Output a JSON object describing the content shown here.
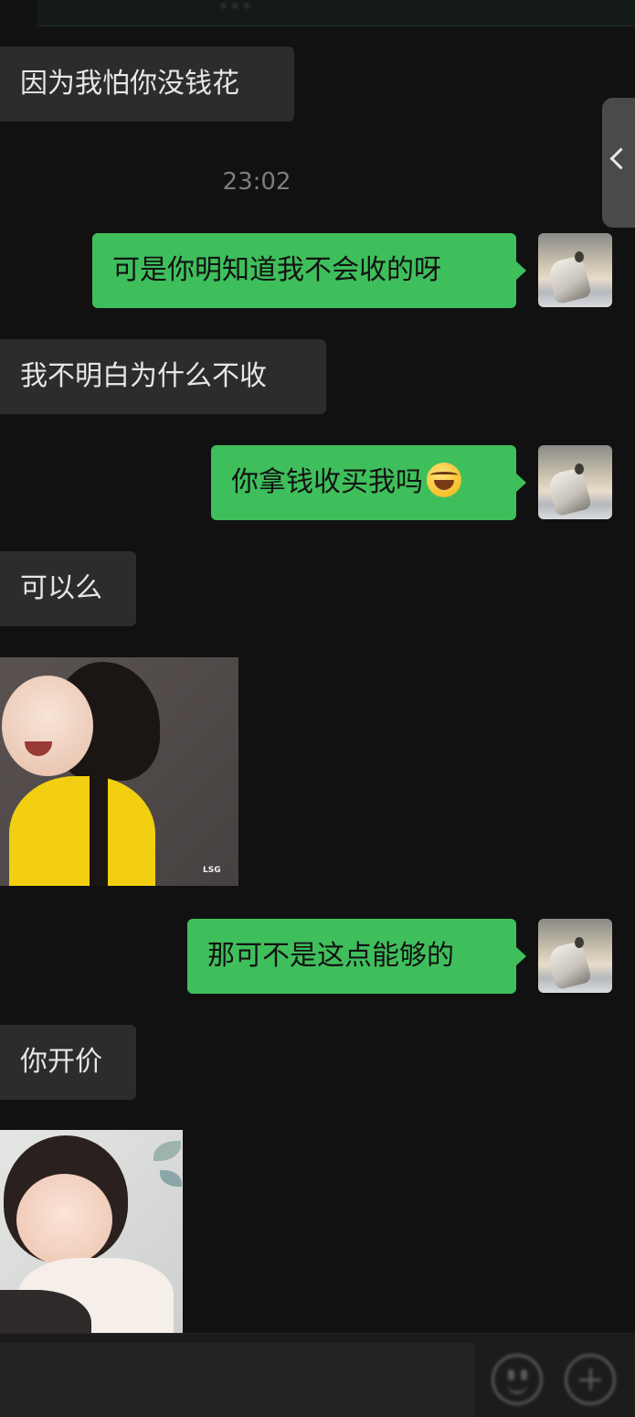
{
  "header": {
    "partial_text": "···"
  },
  "messages": [
    {
      "side": "left",
      "kind": "text",
      "text": "因为我怕你没钱花"
    },
    {
      "kind": "timestamp",
      "text": "23:02"
    },
    {
      "side": "right",
      "kind": "text",
      "text": "可是你明知道我不会收的呀"
    },
    {
      "side": "left",
      "kind": "text",
      "text": "我不明白为什么不收"
    },
    {
      "side": "right",
      "kind": "text",
      "text": "你拿钱收买我吗",
      "emoji": "tears-of-joy-emoji"
    },
    {
      "side": "left",
      "kind": "text",
      "text": "可以么"
    },
    {
      "side": "left",
      "kind": "sticker",
      "icon": "laughing-girl-sticker",
      "watermark": "LSG"
    },
    {
      "side": "right",
      "kind": "text",
      "text": "那可不是这点能够的"
    },
    {
      "side": "left",
      "kind": "text",
      "text": "你开价"
    },
    {
      "side": "left",
      "kind": "sticker",
      "icon": "toddler-girl-sticker"
    }
  ],
  "input_bar": {
    "emoji_icon": "smiley-face-icon",
    "more_icon": "plus-circle-icon"
  },
  "side_panel": {
    "icon": "chevron-left-icon"
  },
  "colors": {
    "background": "#111111",
    "incoming_bubble": "#2c2c2c",
    "outgoing_bubble": "#3fbf5c",
    "incoming_text": "#e6e6e6",
    "outgoing_text": "#121212"
  }
}
